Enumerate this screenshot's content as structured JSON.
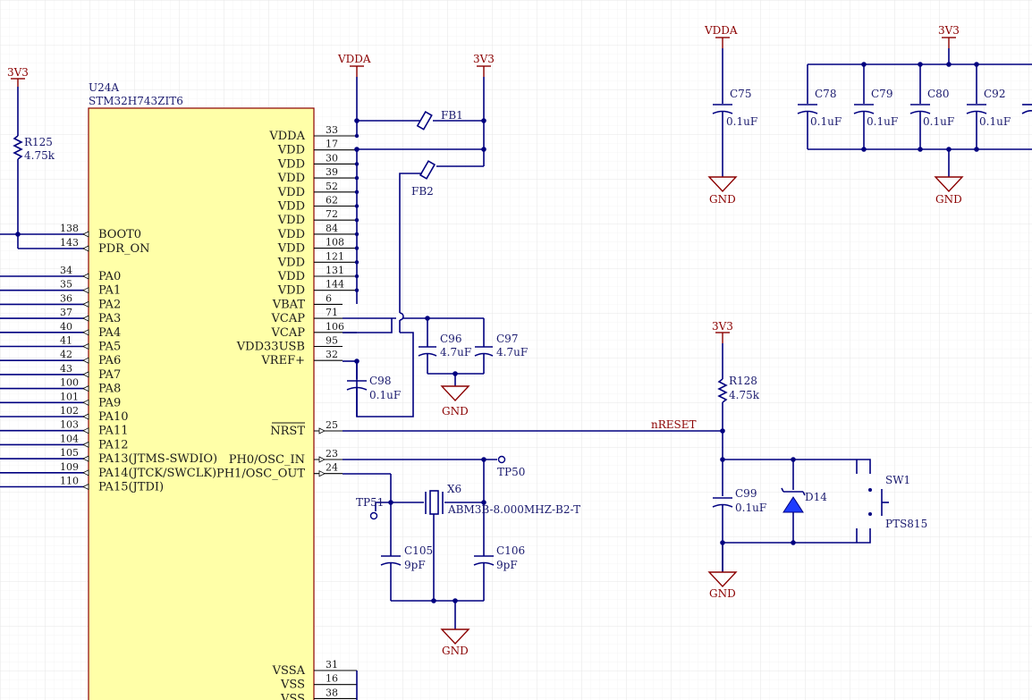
{
  "colors": {
    "background": "#ffffff",
    "grid": "#e9e9e9",
    "wire": "#000080",
    "power": "#8b0000",
    "ic_fill": "#ffffa8",
    "ic_border": "#8b0000",
    "junction": "#000080"
  },
  "ic": {
    "designator": "U24A",
    "part": "STM32H743ZIT6",
    "left_pins": [
      {
        "num": "138",
        "name": "BOOT0"
      },
      {
        "num": "143",
        "name": "PDR_ON"
      },
      {
        "num": "34",
        "name": "PA0"
      },
      {
        "num": "35",
        "name": "PA1"
      },
      {
        "num": "36",
        "name": "PA2"
      },
      {
        "num": "37",
        "name": "PA3"
      },
      {
        "num": "40",
        "name": "PA4"
      },
      {
        "num": "41",
        "name": "PA5"
      },
      {
        "num": "42",
        "name": "PA6"
      },
      {
        "num": "43",
        "name": "PA7"
      },
      {
        "num": "100",
        "name": "PA8"
      },
      {
        "num": "101",
        "name": "PA9"
      },
      {
        "num": "102",
        "name": "PA10"
      },
      {
        "num": "103",
        "name": "PA11"
      },
      {
        "num": "104",
        "name": "PA12"
      },
      {
        "num": "105",
        "name": "PA13(JTMS-SWDIO)"
      },
      {
        "num": "109",
        "name": "PA14(JTCK/SWCLK)"
      },
      {
        "num": "110",
        "name": "PA15(JTDI)"
      }
    ],
    "right_pins": [
      {
        "num": "33",
        "name": "VDDA"
      },
      {
        "num": "17",
        "name": "VDD"
      },
      {
        "num": "30",
        "name": "VDD"
      },
      {
        "num": "39",
        "name": "VDD"
      },
      {
        "num": "52",
        "name": "VDD"
      },
      {
        "num": "62",
        "name": "VDD"
      },
      {
        "num": "72",
        "name": "VDD"
      },
      {
        "num": "84",
        "name": "VDD"
      },
      {
        "num": "108",
        "name": "VDD"
      },
      {
        "num": "121",
        "name": "VDD"
      },
      {
        "num": "131",
        "name": "VDD"
      },
      {
        "num": "144",
        "name": "VDD"
      },
      {
        "num": "6",
        "name": "VBAT"
      },
      {
        "num": "71",
        "name": "VCAP"
      },
      {
        "num": "106",
        "name": "VCAP"
      },
      {
        "num": "95",
        "name": "VDD33USB"
      },
      {
        "num": "32",
        "name": "VREF+"
      }
    ],
    "nrst": {
      "num": "25",
      "name": "NRST"
    },
    "osc_pins": [
      {
        "num": "23",
        "name": "PH0/OSC_IN"
      },
      {
        "num": "24",
        "name": "PH1/OSC_OUT"
      }
    ],
    "bottom_pins": [
      {
        "num": "31",
        "name": "VSSA"
      },
      {
        "num": "16",
        "name": "VSS"
      },
      {
        "num": "38",
        "name": "VSS"
      }
    ]
  },
  "power": {
    "v3v3": "3V3",
    "vdda": "VDDA",
    "gnd": "GND"
  },
  "nets": {
    "nreset": "nRESET"
  },
  "parts": {
    "r125": {
      "ref": "R125",
      "value": "4.75k"
    },
    "r128": {
      "ref": "R128",
      "value": "4.75k"
    },
    "fb1": {
      "ref": "FB1"
    },
    "fb2": {
      "ref": "FB2"
    },
    "c75": {
      "ref": "C75",
      "value": "0.1uF"
    },
    "c78": {
      "ref": "C78",
      "value": "0.1uF"
    },
    "c79": {
      "ref": "C79",
      "value": "0.1uF"
    },
    "c80": {
      "ref": "C80",
      "value": "0.1uF"
    },
    "c92": {
      "ref": "C92",
      "value": "0.1uF"
    },
    "c96": {
      "ref": "C96",
      "value": "4.7uF"
    },
    "c97": {
      "ref": "C97",
      "value": "4.7uF"
    },
    "c98": {
      "ref": "C98",
      "value": "0.1uF"
    },
    "c99": {
      "ref": "C99",
      "value": "0.1uF"
    },
    "c105": {
      "ref": "C105",
      "value": "9pF"
    },
    "c106": {
      "ref": "C106",
      "value": "9pF"
    },
    "x6": {
      "ref": "X6",
      "value": "ABM3B-8.000MHZ-B2-T"
    },
    "tp50": {
      "ref": "TP50"
    },
    "tp51": {
      "ref": "TP51"
    },
    "d14": {
      "ref": "D14"
    },
    "sw1": {
      "ref": "SW1",
      "value": "PTS815"
    }
  }
}
